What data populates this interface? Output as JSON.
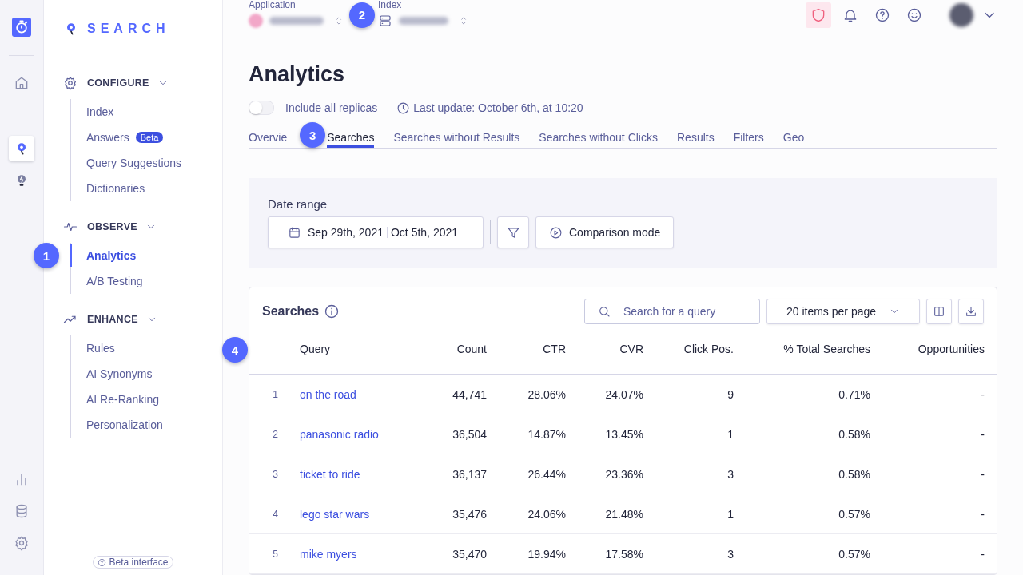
{
  "brand": {
    "name": "SEARCH"
  },
  "rail": {
    "items": [
      {
        "kind": "home",
        "selected": false
      },
      {
        "kind": "search",
        "selected": true
      },
      {
        "kind": "bulb",
        "selected": false
      }
    ],
    "bottom": [
      {
        "kind": "chart"
      },
      {
        "kind": "database"
      },
      {
        "kind": "settings"
      }
    ]
  },
  "sidebar": {
    "sections": [
      {
        "title": "CONFIGURE",
        "expanded": true,
        "items": [
          {
            "label": "Index",
            "selected": false
          },
          {
            "label": "Answers",
            "badge": "Beta",
            "selected": false
          },
          {
            "label": "Query Suggestions",
            "selected": false
          },
          {
            "label": "Dictionaries",
            "selected": false
          }
        ]
      },
      {
        "title": "OBSERVE",
        "expanded": true,
        "items": [
          {
            "label": "Analytics",
            "selected": true,
            "callout": "1"
          },
          {
            "label": "A/B Testing",
            "selected": false
          }
        ]
      },
      {
        "title": "ENHANCE",
        "expanded": true,
        "items": [
          {
            "label": "Rules",
            "selected": false
          },
          {
            "label": "AI Synonyms",
            "selected": false
          },
          {
            "label": "AI Re-Ranking",
            "selected": false
          },
          {
            "label": "Personalization",
            "selected": false
          }
        ]
      }
    ],
    "footer": "Beta interface"
  },
  "topbar": {
    "application_label": "Application",
    "index_label": "Index",
    "callout": "2"
  },
  "page": {
    "title": "Analytics",
    "replicas_toggle": {
      "label": "Include all replicas",
      "on": false
    },
    "last_update": "Last update: October 6th, at 10:20",
    "tabs": [
      {
        "label": "Overvie",
        "selected": false
      },
      {
        "label": "Searches",
        "selected": true,
        "callout": "3"
      },
      {
        "label": "Searches without Results",
        "selected": false
      },
      {
        "label": "Searches without Clicks",
        "selected": false
      },
      {
        "label": "Results",
        "selected": false
      },
      {
        "label": "Filters",
        "selected": false
      },
      {
        "label": "Geo",
        "selected": false
      }
    ]
  },
  "date_range": {
    "label": "Date range",
    "start": "Sep 29th, 2021",
    "end": "Oct 5th, 2021",
    "comparison": "Comparison mode"
  },
  "table": {
    "title": "Searches",
    "search_placeholder": "Search for a query",
    "per_page": "20 items per page",
    "callout": "4",
    "columns": [
      "",
      "Query",
      "Count",
      "CTR",
      "CVR",
      "Click Pos.",
      "% Total Searches",
      "Opportunities"
    ],
    "rows": [
      {
        "cells": [
          "1",
          "on the road",
          "44,741",
          "28.06%",
          "24.07%",
          "9",
          "0.71%",
          "-"
        ]
      },
      {
        "cells": [
          "2",
          "panasonic radio",
          "36,504",
          "14.87%",
          "13.45%",
          "1",
          "0.58%",
          "-"
        ]
      },
      {
        "cells": [
          "3",
          "ticket to ride",
          "36,137",
          "26.44%",
          "23.36%",
          "3",
          "0.58%",
          "-"
        ]
      },
      {
        "cells": [
          "4",
          "lego star wars",
          "35,476",
          "24.06%",
          "21.48%",
          "1",
          "0.57%",
          "-"
        ]
      },
      {
        "cells": [
          "5",
          "mike myers",
          "35,470",
          "19.94%",
          "17.58%",
          "3",
          "0.57%",
          "-"
        ]
      }
    ]
  }
}
